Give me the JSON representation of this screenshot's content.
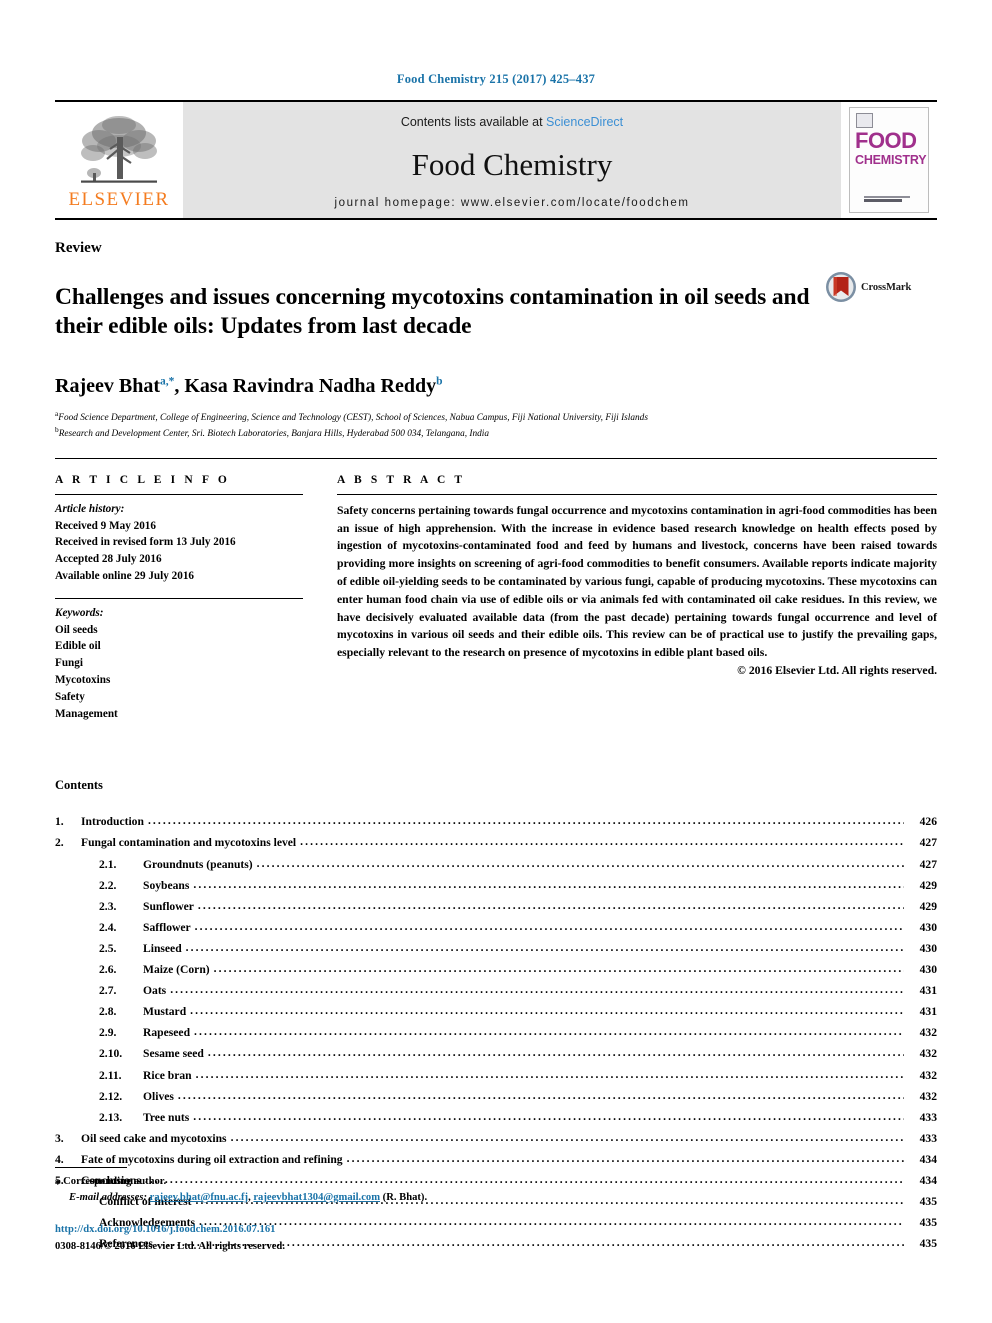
{
  "running_head": "Food Chemistry 215 (2017) 425–437",
  "masthead": {
    "contents_prefix": "Contents lists available at ",
    "sciencedirect": "ScienceDirect",
    "journal_name": "Food Chemistry",
    "homepage": "journal homepage: www.elsevier.com/locate/foodchem",
    "publisher_wordmark": "ELSEVIER",
    "cover": {
      "line1": "FOOD",
      "line2": "CHEMISTRY"
    },
    "colors": {
      "link": "#3b8fd4",
      "running_head": "#1a73a8",
      "elsevier_orange": "#F47C20",
      "cover_magenta": "#a0308c",
      "masthead_bg": "#e3e3e3"
    }
  },
  "article": {
    "type": "Review",
    "title": "Challenges and issues concerning mycotoxins contamination in oil seeds and their edible oils: Updates from last decade",
    "crossmark_label": "CrossMark",
    "authors": [
      {
        "name": "Rajeev Bhat",
        "marks": "a,*"
      },
      {
        "name": "Kasa Ravindra Nadha Reddy",
        "marks": "b"
      }
    ],
    "affiliations": [
      {
        "mark": "a",
        "text": "Food Science Department, College of Engineering, Science and Technology (CEST), School of Sciences, Nabua Campus, Fiji National University, Fiji Islands"
      },
      {
        "mark": "b",
        "text": "Research and Development Center, Sri. Biotech Laboratories, Banjara Hills, Hyderabad 500 034, Telangana, India"
      }
    ]
  },
  "article_info": {
    "heading": "A R T I C L E    I N F O",
    "history_label": "Article history:",
    "history": [
      "Received 9 May 2016",
      "Received in revised form 13 July 2016",
      "Accepted 28 July 2016",
      "Available online 29 July 2016"
    ],
    "keywords_label": "Keywords:",
    "keywords": [
      "Oil seeds",
      "Edible oil",
      "Fungi",
      "Mycotoxins",
      "Safety",
      "Management"
    ]
  },
  "abstract": {
    "heading": "A B S T R A C T",
    "text": "Safety concerns pertaining towards fungal occurrence and mycotoxins contamination in agri-food commodities has been an issue of high apprehension. With the increase in evidence based research knowledge on health effects posed by ingestion of mycotoxins-contaminated food and feed by humans and livestock, concerns have been raised towards providing more insights on screening of agri-food commodities to benefit consumers. Available reports indicate majority of edible oil-yielding seeds to be contaminated by various fungi, capable of producing mycotoxins. These mycotoxins can enter human food chain via use of edible oils or via animals fed with contaminated oil cake residues. In this review, we have decisively evaluated available data (from the past decade) pertaining towards fungal occurrence and level of mycotoxins in various oil seeds and their edible oils. This review can be of practical use to justify the prevailing gaps, especially relevant to the research on presence of mycotoxins in edible plant based oils.",
    "copyright": "© 2016 Elsevier Ltd. All rights reserved."
  },
  "contents": {
    "heading": "Contents",
    "entries": [
      {
        "level": 1,
        "num": "1.",
        "label": "Introduction",
        "page": "426"
      },
      {
        "level": 1,
        "num": "2.",
        "label": "Fungal contamination and mycotoxins level",
        "page": "427"
      },
      {
        "level": 2,
        "num": "2.1.",
        "label": "Groundnuts (peanuts)",
        "page": "427"
      },
      {
        "level": 2,
        "num": "2.2.",
        "label": "Soybeans",
        "page": "429"
      },
      {
        "level": 2,
        "num": "2.3.",
        "label": "Sunflower",
        "page": "429"
      },
      {
        "level": 2,
        "num": "2.4.",
        "label": "Safflower",
        "page": "430"
      },
      {
        "level": 2,
        "num": "2.5.",
        "label": "Linseed",
        "page": "430"
      },
      {
        "level": 2,
        "num": "2.6.",
        "label": "Maize (Corn)",
        "page": "430"
      },
      {
        "level": 2,
        "num": "2.7.",
        "label": "Oats",
        "page": "431"
      },
      {
        "level": 2,
        "num": "2.8.",
        "label": "Mustard",
        "page": "431"
      },
      {
        "level": 2,
        "num": "2.9.",
        "label": "Rapeseed",
        "page": "432"
      },
      {
        "level": 2,
        "num": "2.10.",
        "label": "Sesame seed",
        "page": "432"
      },
      {
        "level": 2,
        "num": "2.11.",
        "label": "Rice bran",
        "page": "432"
      },
      {
        "level": 2,
        "num": "2.12.",
        "label": "Olives",
        "page": "432"
      },
      {
        "level": 2,
        "num": "2.13.",
        "label": "Tree nuts",
        "page": "433"
      },
      {
        "level": 1,
        "num": "3.",
        "label": "Oil seed cake and mycotoxins",
        "page": "433"
      },
      {
        "level": 1,
        "num": "4.",
        "label": "Fate of mycotoxins during oil extraction and refining",
        "page": "434"
      },
      {
        "level": 1,
        "num": "5.",
        "label": "Conclusions",
        "page": "434"
      },
      {
        "level": 3,
        "num": "",
        "label": "Conflict of interest",
        "page": "435"
      },
      {
        "level": 3,
        "num": "",
        "label": "Acknowledgements",
        "page": "435"
      },
      {
        "level": 3,
        "num": "",
        "label": "References",
        "page": "435"
      }
    ]
  },
  "footnotes": {
    "corresponding_star": "⁎",
    "corresponding_text": "Corresponding author.",
    "email_label": "E-mail addresses:",
    "email_1": "rajeev.bhat@fnu.ac.fj",
    "email_sep": ", ",
    "email_2": "rajeevbhat1304@gmail.com",
    "email_owner": "(R. Bhat).",
    "doi": "http://dx.doi.org/10.1016/j.foodchem.2016.07.161",
    "issn": "0308-8146/© 2016 Elsevier Ltd. All rights reserved."
  }
}
